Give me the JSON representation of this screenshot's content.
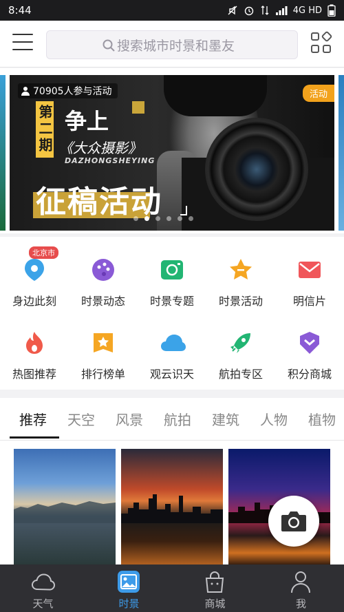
{
  "status_bar": {
    "time": "8:44",
    "dots": "•••",
    "network": "4G HD"
  },
  "search": {
    "placeholder": "搜索城市时景和墨友"
  },
  "banner": {
    "participants": "70905人参与活动",
    "tag": "活动",
    "issue": "第二期",
    "headline_1": "争上",
    "headline_2": "《大众摄影》",
    "headline_en": "DAZHONGSHEYING",
    "headline_3": "征稿活动",
    "dot_count": 6,
    "active_dot": 1
  },
  "grid": {
    "city_badge": "北京市",
    "row1": [
      {
        "label": "身边此刻",
        "icon": "location-pin-icon",
        "color": "#3ba3e8"
      },
      {
        "label": "时景动态",
        "icon": "palette-icon",
        "color": "#8a5ad6"
      },
      {
        "label": "时景专题",
        "icon": "camera-icon",
        "color": "#22b573"
      },
      {
        "label": "时景活动",
        "icon": "star-icon",
        "color": "#f5a623"
      },
      {
        "label": "明信片",
        "icon": "envelope-icon",
        "color": "#f0565a"
      }
    ],
    "row2": [
      {
        "label": "热图推荐",
        "icon": "flame-icon",
        "color": "#f05a4a"
      },
      {
        "label": "排行榜单",
        "icon": "rank-star-icon",
        "color": "#f5a623"
      },
      {
        "label": "观云识天",
        "icon": "cloud-icon",
        "color": "#3ba3e8"
      },
      {
        "label": "航拍专区",
        "icon": "rocket-icon",
        "color": "#22b573"
      },
      {
        "label": "积分商城",
        "icon": "heart-chevron-icon",
        "color": "#8a5ad6"
      }
    ]
  },
  "tabs": [
    "推荐",
    "天空",
    "风景",
    "航拍",
    "建筑",
    "人物",
    "植物"
  ],
  "bottom_nav": [
    {
      "label": "天气",
      "icon": "cloud-outline-icon"
    },
    {
      "label": "时景",
      "icon": "image-icon"
    },
    {
      "label": "商城",
      "icon": "shopping-bag-icon"
    },
    {
      "label": "我",
      "icon": "profile-icon"
    }
  ]
}
